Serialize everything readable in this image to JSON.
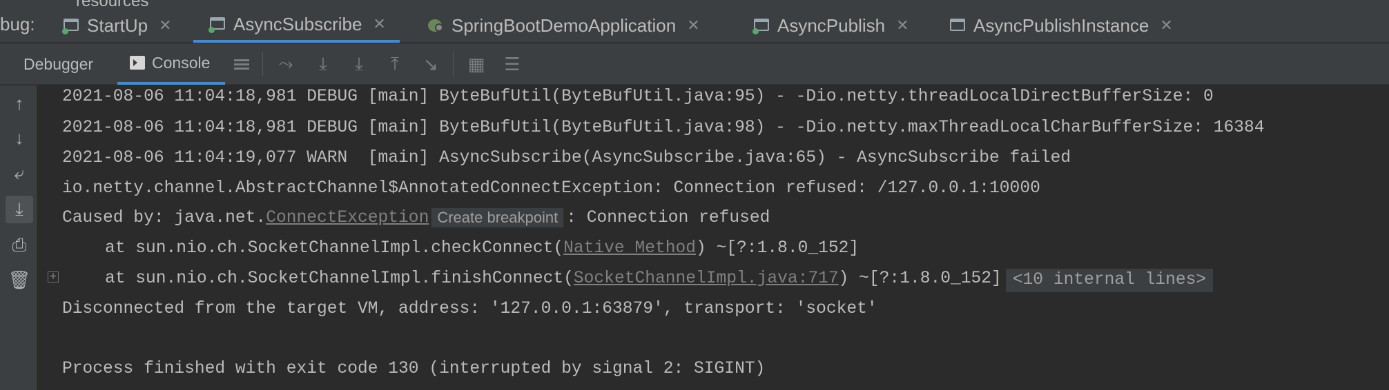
{
  "top": {
    "partial_label": "resources"
  },
  "debug_tabs": {
    "label_fragment": "bug:",
    "tabs": [
      {
        "label": "StartUp",
        "icon": "run-config-icon"
      },
      {
        "label": "AsyncSubscribe",
        "icon": "run-config-icon",
        "active": true
      },
      {
        "label": "SpringBootDemoApplication",
        "icon": "spring-boot-icon"
      },
      {
        "label": "AsyncPublish",
        "icon": "run-config-icon"
      },
      {
        "label": "AsyncPublishInstance",
        "icon": "run-config-icon"
      }
    ]
  },
  "toolbar": {
    "debugger_label": "Debugger",
    "console_label": "Console"
  },
  "console": {
    "lines": [
      "2021-08-06 11:04:18,981 DEBUG [main] ByteBufUtil(ByteBufUtil.java:95) - -Dio.netty.threadLocalDirectBufferSize: 0",
      "2021-08-06 11:04:18,981 DEBUG [main] ByteBufUtil(ByteBufUtil.java:98) - -Dio.netty.maxThreadLocalCharBufferSize: 16384",
      "2021-08-06 11:04:19,077 WARN  [main] AsyncSubscribe(AsyncSubscribe.java:65) - AsyncSubscribe failed",
      "io.netty.channel.AbstractChannel$AnnotatedConnectException: Connection refused: /127.0.0.1:10000"
    ],
    "caused_by": {
      "prefix": "Caused by: java.net.",
      "link": "ConnectException",
      "tooltip": "Create breakpoint",
      "suffix": ": Connection refused"
    },
    "frame1": {
      "prefix": "at sun.nio.ch.SocketChannelImpl.checkConnect(",
      "link": "Native Method",
      "suffix": ") ~[?:1.8.0_152]"
    },
    "frame2": {
      "prefix": "at sun.nio.ch.SocketChannelImpl.finishConnect(",
      "link": "SocketChannelImpl.java:717",
      "suffix": ") ~[?:1.8.0_152]",
      "folded": "<10 internal lines>"
    },
    "disconnected": "Disconnected from the target VM, address: '127.0.0.1:63879', transport: 'socket'",
    "finished": "Process finished with exit code 130 (interrupted by signal 2: SIGINT)"
  }
}
